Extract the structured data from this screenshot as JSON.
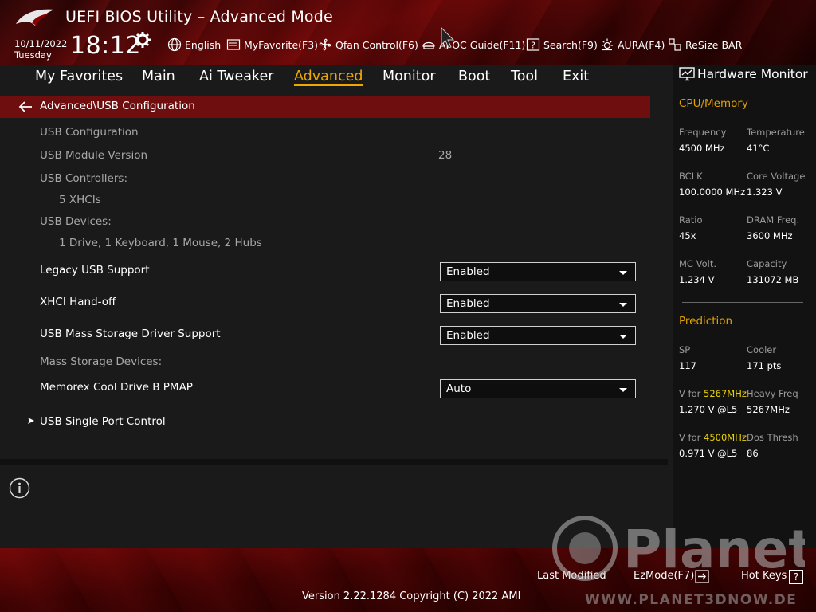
{
  "header": {
    "title": "UEFI BIOS Utility – Advanced Mode",
    "date": "10/11/2022",
    "day": "Tuesday",
    "time": "18:12",
    "toolbar": {
      "language": "English",
      "myfavorite": "MyFavorite(F3)",
      "qfan": "Qfan Control(F6)",
      "ai_oc": "AI OC Guide(F11)",
      "search": "Search(F9)",
      "aura": "AURA(F4)",
      "resize_bar": "ReSize BAR"
    }
  },
  "nav": {
    "tabs": [
      "My Favorites",
      "Main",
      "Ai Tweaker",
      "Advanced",
      "Monitor",
      "Boot",
      "Tool",
      "Exit"
    ],
    "active": "Advanced"
  },
  "main": {
    "breadcrumb": "Advanced\\USB Configuration",
    "usb_configuration": "USB Configuration",
    "usb_module_version_label": "USB Module Version",
    "usb_module_version_value": "28",
    "usb_controllers_label": "USB Controllers:",
    "usb_controllers_value": "5 XHCIs",
    "usb_devices_label": "USB Devices:",
    "usb_devices_value": "1 Drive, 1 Keyboard, 1 Mouse, 2 Hubs",
    "legacy_usb_label": "Legacy USB Support",
    "legacy_usb_value": "Enabled",
    "xhci_label": "XHCI Hand-off",
    "xhci_value": "Enabled",
    "mass_storage_driver_label": "USB Mass Storage Driver Support",
    "mass_storage_driver_value": "Enabled",
    "mass_storage_devices_label": "Mass Storage Devices:",
    "memorex_label": "Memorex Cool Drive B PMAP",
    "memorex_value": "Auto",
    "single_port_label": "USB Single Port Control"
  },
  "hwmon": {
    "title": "Hardware Monitor",
    "cpu_section": "CPU/Memory",
    "frequency_label": "Frequency",
    "frequency_value": "4500 MHz",
    "temperature_label": "Temperature",
    "temperature_value": "41°C",
    "bclk_label": "BCLK",
    "bclk_value": "100.0000 MHz",
    "core_voltage_label": "Core Voltage",
    "core_voltage_value": "1.323 V",
    "ratio_label": "Ratio",
    "ratio_value": "45x",
    "dram_freq_label": "DRAM Freq.",
    "dram_freq_value": "3600 MHz",
    "mc_volt_label": "MC Volt.",
    "mc_volt_value": "1.234 V",
    "capacity_label": "Capacity",
    "capacity_value": "131072 MB",
    "prediction_section": "Prediction",
    "sp_label": "SP",
    "sp_value": "117",
    "cooler_label": "Cooler",
    "cooler_value": "171 pts",
    "vfor1_prefix": "V for ",
    "vfor1_freq": "5267MHz",
    "vfor1_value": "1.270 V @L5",
    "heavy_freq_label": "Heavy Freq",
    "heavy_freq_value": "5267MHz",
    "vfor2_prefix": "V for ",
    "vfor2_freq": "4500MHz",
    "vfor2_value": "0.971 V @L5",
    "dos_thresh_label": "Dos Thresh",
    "dos_thresh_value": "86"
  },
  "footer": {
    "last_modified": "Last Modified",
    "ezmode": "EzMode(F7)",
    "hotkeys": "Hot Keys",
    "hotkeys_icon": "?",
    "version": "Version 2.22.1284 Copyright (C) 2022 AMI"
  },
  "watermark": {
    "brand": "Planet",
    "url": "WWW.PLANET3DNOW.DE"
  },
  "colors": {
    "accent": "#f0a800",
    "breadcrumb_bg": "#6e0e0e",
    "highlight": "#e8d000"
  }
}
